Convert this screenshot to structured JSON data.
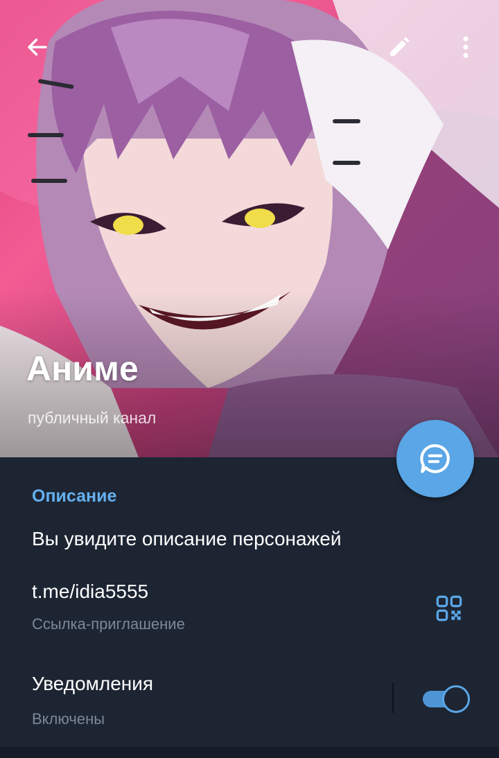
{
  "header": {
    "title": "Аниме",
    "subtitle": "публичный канал",
    "back_icon": "arrow-left-icon",
    "edit_icon": "pencil-icon",
    "more_icon": "more-vertical-icon",
    "cover_image": "anime-character-avatar"
  },
  "fab": {
    "icon": "chat-bubble-icon"
  },
  "description": {
    "heading": "Описание",
    "text": "Вы увидите описание персонажей"
  },
  "invite": {
    "link": "t.me/idia5555",
    "caption": "Ссылка-приглашение",
    "qr_icon": "qr-code-icon"
  },
  "notifications": {
    "title": "Уведомления",
    "state": "Включены",
    "enabled": true
  },
  "colors": {
    "background": "#1d2533",
    "accent": "#5aa6e6",
    "heading": "#64b0ee",
    "secondary_text": "#7c8898"
  }
}
